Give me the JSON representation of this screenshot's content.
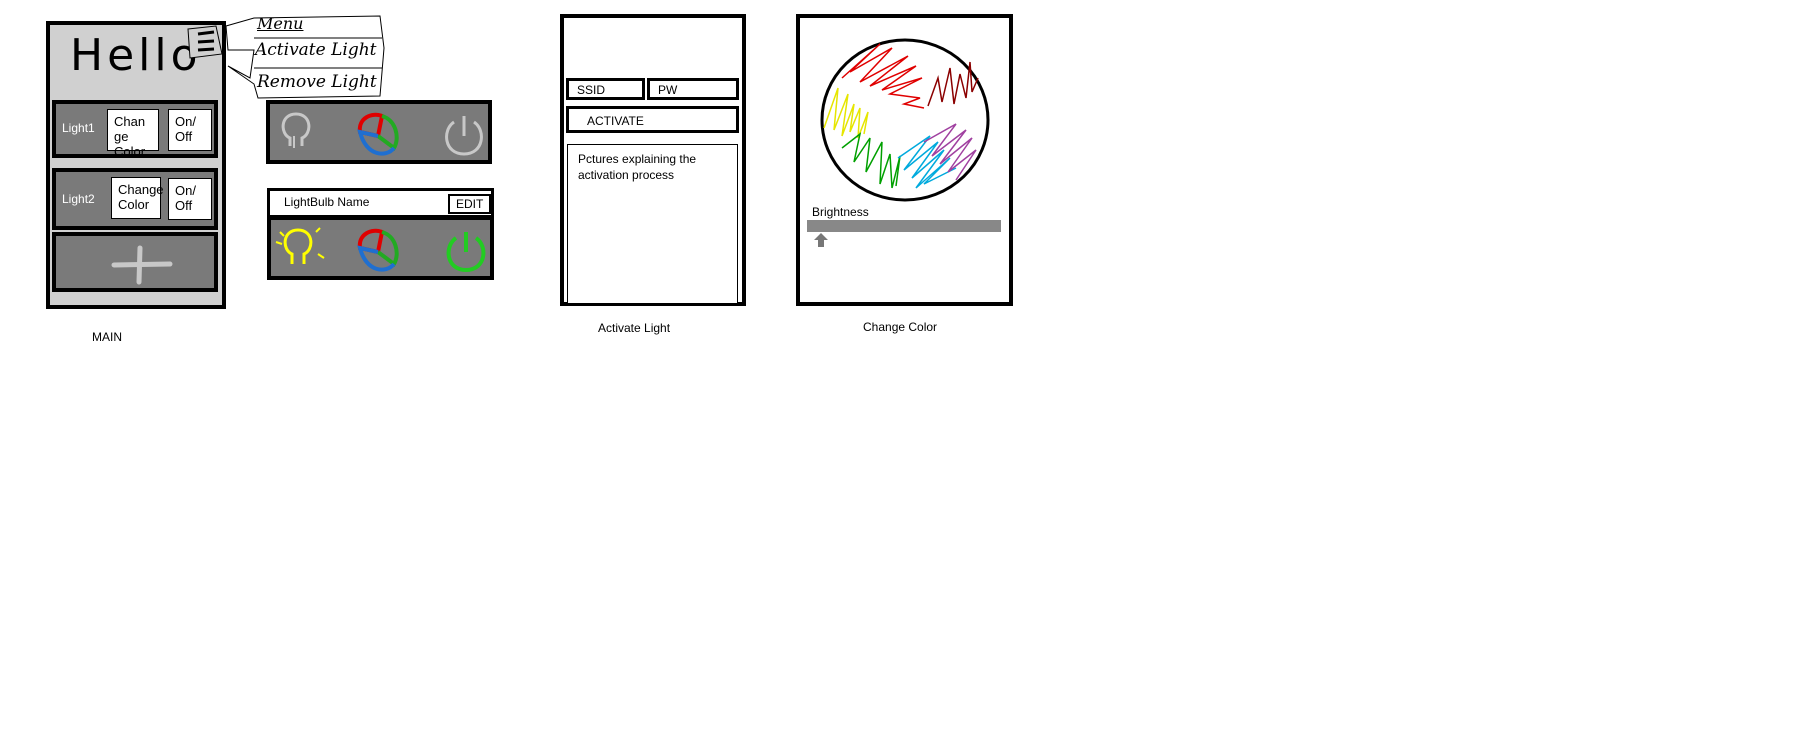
{
  "main": {
    "greeting": "Hello",
    "menu_popup": {
      "items": [
        "Menu",
        "Activate Light",
        "Remove Light"
      ]
    },
    "lights": [
      {
        "name": "Light1",
        "change_color": "Change Color",
        "on_off": "On/ Off"
      },
      {
        "name": "Light2",
        "change_color": "Change Color",
        "on_off": "On/ Off"
      }
    ],
    "caption": "MAIN",
    "icons": [
      "hamburger-menu-icon",
      "add-icon"
    ]
  },
  "light_controls": {
    "bulb_name": "LightBulb Name",
    "edit_label": "EDIT",
    "icons": [
      "bulb-icon",
      "color-wheel-icon",
      "power-icon"
    ],
    "colors": {
      "bulb_on": "#ffff00",
      "power_on": "#22cc22",
      "inactive": "#c8c8c8"
    }
  },
  "activate_light": {
    "ssid_label": "SSID",
    "pw_label": "PW",
    "activate_label": "ACTIVATE",
    "explanation": "Pctures explaining the activation process",
    "caption": "Activate Light"
  },
  "change_color": {
    "brightness_label": "Brightness",
    "caption": "Change Color",
    "wheel_colors": [
      "#e00000",
      "#8b0000",
      "#a040a0",
      "#00aadd",
      "#00a000",
      "#e6e600"
    ]
  }
}
